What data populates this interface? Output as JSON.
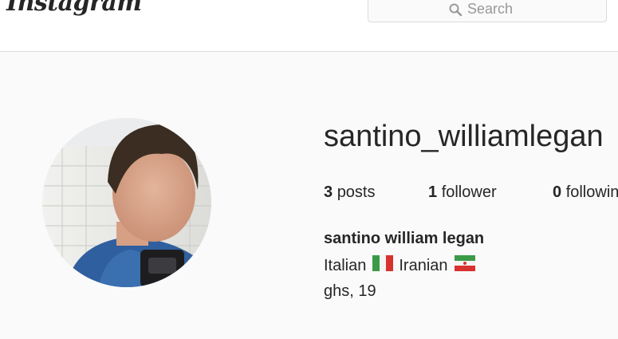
{
  "header": {
    "logo_text": "Instagram",
    "search": {
      "placeholder": "Search",
      "icon": "search-icon"
    }
  },
  "profile": {
    "username": "santino_williamlegan",
    "avatar": "profile-photo",
    "stats": {
      "posts": {
        "count": "3",
        "label": "posts"
      },
      "followers": {
        "count": "1",
        "label": "follower"
      },
      "following": {
        "count": "0",
        "label": "following"
      }
    },
    "full_name": "santino william legan",
    "bio": {
      "line1": {
        "part1": "Italian",
        "flag1": "italy-flag-icon",
        "part2": "Iranian",
        "flag2": "iran-flag-icon"
      },
      "line2": "ghs, 19"
    }
  },
  "colors": {
    "background": "#fafafa",
    "text": "#262626",
    "border": "#dbdbdb",
    "placeholder": "#999999"
  }
}
